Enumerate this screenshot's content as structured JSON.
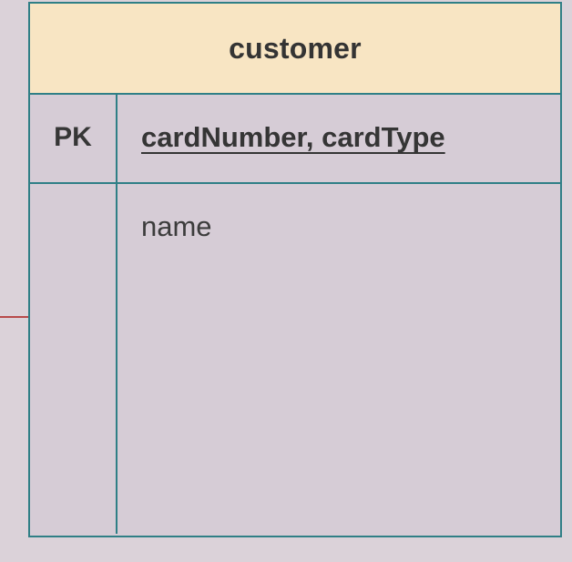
{
  "entity": {
    "title": "customer",
    "key_label": "PK",
    "primary_key_fields": "cardNumber, cardType",
    "attributes": [
      "name"
    ]
  },
  "colors": {
    "background": "#dbd2d9",
    "header_fill": "#f8e5c3",
    "border": "#2f7f86",
    "connector": "#b84a4a"
  }
}
